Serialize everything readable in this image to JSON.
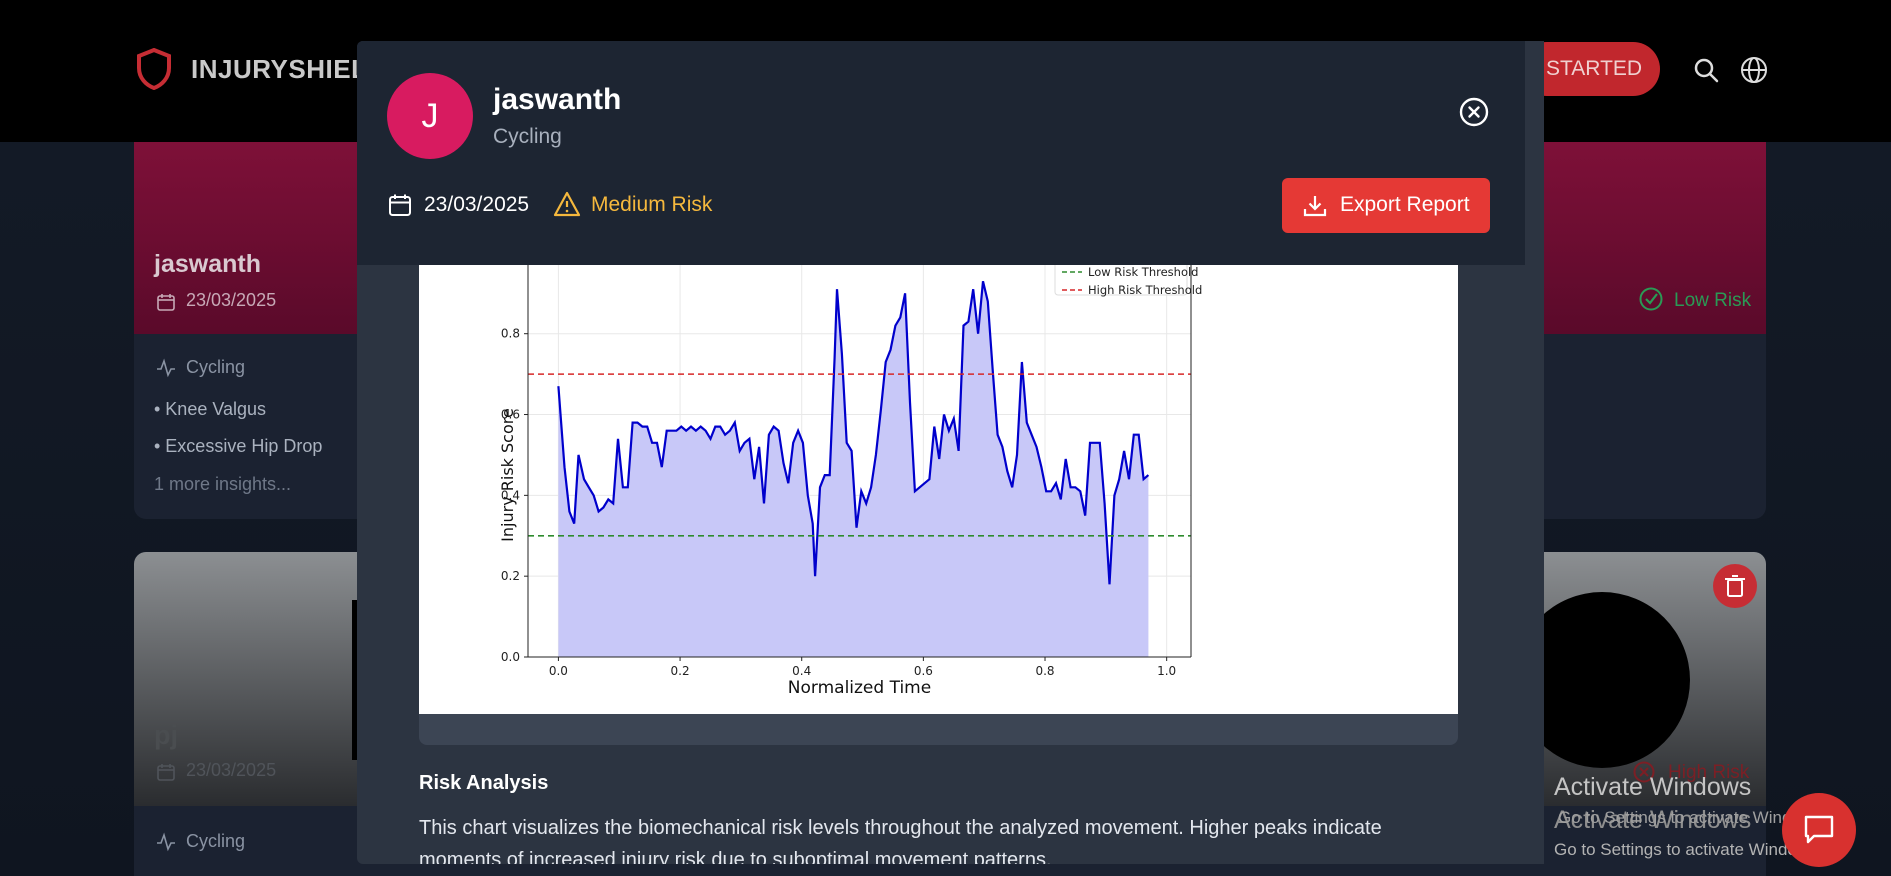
{
  "nav": {
    "brand": "INJURYSHIELD",
    "cta_label": "STARTED"
  },
  "cards": [
    {
      "name": "jaswanth",
      "date": "23/03/2025",
      "risk": "Low Risk",
      "sport": "Cycling",
      "insights": [
        "• Knee Valgus",
        "• Excessive Hip Drop"
      ],
      "more": "1 more insights..."
    },
    {
      "name": "pj",
      "date": "23/03/2025",
      "risk": "High Risk",
      "sport": "Cycling"
    }
  ],
  "modal": {
    "avatar_letter": "J",
    "name": "jaswanth",
    "sport": "Cycling",
    "date": "23/03/2025",
    "risk": "Medium Risk",
    "export_label": "Export Report",
    "risk_analysis_title": "Risk Analysis",
    "risk_analysis_text": "This chart visualizes the biomechanical risk levels throughout the analyzed movement. Higher peaks indicate moments of increased injury risk due to suboptimal movement patterns."
  },
  "overlay": {
    "activate_title": "Activate Windows",
    "activate_sub": "Go to Settings to activate Windows."
  },
  "colors": {
    "avatar": "#d81b60",
    "export": "#e53935",
    "medium_risk": "#f5b83d",
    "low_risk": "#2a9a55",
    "chart_line": "#0000cc",
    "chart_fill": "#c8c8f8"
  },
  "chart_data": {
    "type": "area",
    "xlabel": "Normalized Time",
    "ylabel": "Injury Risk Score",
    "xlim": [
      -0.05,
      1.04
    ],
    "ylim": [
      0.0,
      0.97
    ],
    "xticks": [
      0.0,
      0.2,
      0.4,
      0.6,
      0.8,
      1.0
    ],
    "xtick_labels": [
      "0.0",
      "0.2",
      "0.4",
      "0.6",
      "0.8",
      "1.0"
    ],
    "yticks": [
      0.0,
      0.2,
      0.4,
      0.6,
      0.8
    ],
    "ytick_labels": [
      "0.0",
      "0.2",
      "0.4",
      "0.6",
      "0.8"
    ],
    "grid": true,
    "legend_position": "top-right",
    "thresholds": [
      {
        "name": "Low Risk Threshold",
        "value": 0.3,
        "color": "#2e8b2e"
      },
      {
        "name": "High Risk Threshold",
        "value": 0.7,
        "color": "#d62728"
      }
    ],
    "series": [
      {
        "points": [
          [
            0.0,
            0.67
          ],
          [
            0.01,
            0.47
          ],
          [
            0.018,
            0.36
          ],
          [
            0.026,
            0.33
          ],
          [
            0.033,
            0.5
          ],
          [
            0.042,
            0.44
          ],
          [
            0.05,
            0.42
          ],
          [
            0.058,
            0.4
          ],
          [
            0.066,
            0.36
          ],
          [
            0.074,
            0.37
          ],
          [
            0.082,
            0.39
          ],
          [
            0.09,
            0.38
          ],
          [
            0.098,
            0.54
          ],
          [
            0.106,
            0.42
          ],
          [
            0.114,
            0.42
          ],
          [
            0.122,
            0.58
          ],
          [
            0.13,
            0.58
          ],
          [
            0.138,
            0.57
          ],
          [
            0.146,
            0.57
          ],
          [
            0.154,
            0.53
          ],
          [
            0.162,
            0.53
          ],
          [
            0.17,
            0.47
          ],
          [
            0.178,
            0.56
          ],
          [
            0.186,
            0.56
          ],
          [
            0.194,
            0.56
          ],
          [
            0.202,
            0.57
          ],
          [
            0.21,
            0.56
          ],
          [
            0.218,
            0.57
          ],
          [
            0.226,
            0.56
          ],
          [
            0.234,
            0.57
          ],
          [
            0.242,
            0.56
          ],
          [
            0.25,
            0.54
          ],
          [
            0.258,
            0.57
          ],
          [
            0.266,
            0.57
          ],
          [
            0.274,
            0.55
          ],
          [
            0.282,
            0.56
          ],
          [
            0.29,
            0.58
          ],
          [
            0.298,
            0.51
          ],
          [
            0.306,
            0.53
          ],
          [
            0.314,
            0.54
          ],
          [
            0.322,
            0.44
          ],
          [
            0.33,
            0.52
          ],
          [
            0.338,
            0.38
          ],
          [
            0.346,
            0.55
          ],
          [
            0.354,
            0.57
          ],
          [
            0.362,
            0.56
          ],
          [
            0.37,
            0.48
          ],
          [
            0.378,
            0.43
          ],
          [
            0.386,
            0.53
          ],
          [
            0.394,
            0.56
          ],
          [
            0.402,
            0.53
          ],
          [
            0.41,
            0.4
          ],
          [
            0.418,
            0.33
          ],
          [
            0.422,
            0.2
          ],
          [
            0.43,
            0.42
          ],
          [
            0.438,
            0.45
          ],
          [
            0.446,
            0.45
          ],
          [
            0.454,
            0.74
          ],
          [
            0.458,
            0.91
          ],
          [
            0.466,
            0.75
          ],
          [
            0.474,
            0.53
          ],
          [
            0.482,
            0.51
          ],
          [
            0.49,
            0.32
          ],
          [
            0.498,
            0.41
          ],
          [
            0.506,
            0.38
          ],
          [
            0.514,
            0.42
          ],
          [
            0.522,
            0.5
          ],
          [
            0.53,
            0.61
          ],
          [
            0.538,
            0.73
          ],
          [
            0.546,
            0.76
          ],
          [
            0.554,
            0.82
          ],
          [
            0.562,
            0.84
          ],
          [
            0.57,
            0.9
          ],
          [
            0.578,
            0.63
          ],
          [
            0.586,
            0.41
          ],
          [
            0.594,
            0.42
          ],
          [
            0.602,
            0.43
          ],
          [
            0.61,
            0.44
          ],
          [
            0.618,
            0.57
          ],
          [
            0.626,
            0.49
          ],
          [
            0.634,
            0.6
          ],
          [
            0.642,
            0.56
          ],
          [
            0.65,
            0.59
          ],
          [
            0.658,
            0.51
          ],
          [
            0.666,
            0.82
          ],
          [
            0.674,
            0.83
          ],
          [
            0.682,
            0.91
          ],
          [
            0.69,
            0.8
          ],
          [
            0.698,
            0.93
          ],
          [
            0.706,
            0.88
          ],
          [
            0.714,
            0.71
          ],
          [
            0.722,
            0.55
          ],
          [
            0.73,
            0.52
          ],
          [
            0.738,
            0.46
          ],
          [
            0.746,
            0.42
          ],
          [
            0.754,
            0.5
          ],
          [
            0.762,
            0.73
          ],
          [
            0.77,
            0.58
          ],
          [
            0.778,
            0.55
          ],
          [
            0.786,
            0.52
          ],
          [
            0.794,
            0.47
          ],
          [
            0.802,
            0.41
          ],
          [
            0.81,
            0.41
          ],
          [
            0.818,
            0.43
          ],
          [
            0.826,
            0.39
          ],
          [
            0.834,
            0.49
          ],
          [
            0.842,
            0.42
          ],
          [
            0.85,
            0.42
          ],
          [
            0.858,
            0.41
          ],
          [
            0.866,
            0.35
          ],
          [
            0.874,
            0.53
          ],
          [
            0.882,
            0.53
          ],
          [
            0.89,
            0.53
          ],
          [
            0.898,
            0.38
          ],
          [
            0.906,
            0.18
          ],
          [
            0.914,
            0.4
          ],
          [
            0.922,
            0.44
          ],
          [
            0.93,
            0.51
          ],
          [
            0.938,
            0.44
          ],
          [
            0.946,
            0.55
          ],
          [
            0.954,
            0.55
          ],
          [
            0.962,
            0.44
          ],
          [
            0.97,
            0.45
          ]
        ]
      }
    ]
  }
}
